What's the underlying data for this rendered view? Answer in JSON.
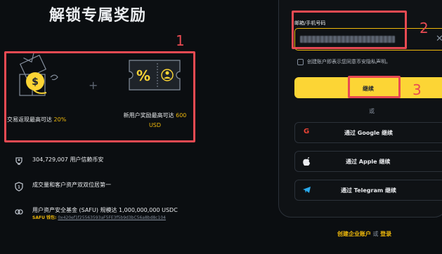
{
  "promo": {
    "title": "解锁专属奖励",
    "reward1": {
      "prefix": "交易返现最高可达 ",
      "value": "20%"
    },
    "reward2": {
      "prefix": "新用户奖励最高可达 ",
      "value": "600",
      "unit": "USD"
    },
    "plus": "+"
  },
  "stats": [
    {
      "icon": "trophy-icon",
      "text": "304,729,007 用户信赖币安"
    },
    {
      "icon": "shield-icon",
      "text": "成交量和客户资产双双位居第一"
    },
    {
      "icon": "link-icon",
      "text": "用户资产安全基金 (SAFU) 规模达 1,000,000,000 USDC",
      "sub_label": "SAFU 钱包:",
      "sub_value": "0x420ef1f25563593aF5FE3f5b9d3bC56a8bd8c104"
    }
  ],
  "annotations": {
    "n1": "1",
    "n2": "2",
    "n3": "3"
  },
  "form": {
    "field_label": "邮箱/手机号码",
    "clear_icon": "close-icon",
    "consent": "创建账户即表示您同意币安隐私声明。",
    "continue_label": "继续",
    "or_label": "或",
    "google_label": "通过 Google 继续",
    "apple_label": "通过 Apple 继续",
    "telegram_label": "通过 Telegram 继续",
    "create_business": "创建企业账户",
    "or_word": "或",
    "login": "登录"
  },
  "colors": {
    "accent": "#fcd535",
    "annotation": "#e84a52",
    "background": "#0b0e11"
  }
}
